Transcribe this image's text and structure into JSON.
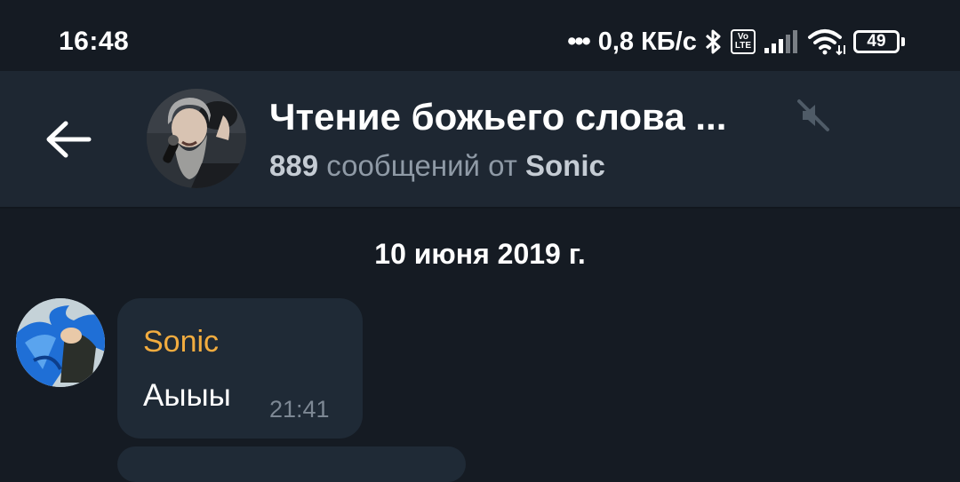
{
  "status_bar": {
    "time": "16:48",
    "dots": "•••",
    "speed": "0,8 КБ/с",
    "volte_top": "Vo",
    "volte_bottom": "LTE",
    "battery": "49",
    "icons": [
      "bluetooth-icon",
      "volte-icon",
      "signal-icon",
      "wifi-icon",
      "battery-icon"
    ]
  },
  "header": {
    "back_icon": "arrow-left-icon",
    "title": "Чтение божьего слова ...",
    "mute_icon": "volume-off-icon",
    "subtitle_count": "889",
    "subtitle_middle": " сообщений от ",
    "subtitle_author": "Sonic"
  },
  "chat": {
    "date": "10 июня 2019 г.",
    "messages": [
      {
        "sender": "Sonic",
        "text": "Аыыы",
        "time": "21:41"
      }
    ]
  },
  "colors": {
    "background": "#151b23",
    "header_bg": "#1e2732",
    "bubble_bg": "#1f2a36",
    "sender_name": "#f2ac3f",
    "muted_text": "#8f9aa6"
  }
}
